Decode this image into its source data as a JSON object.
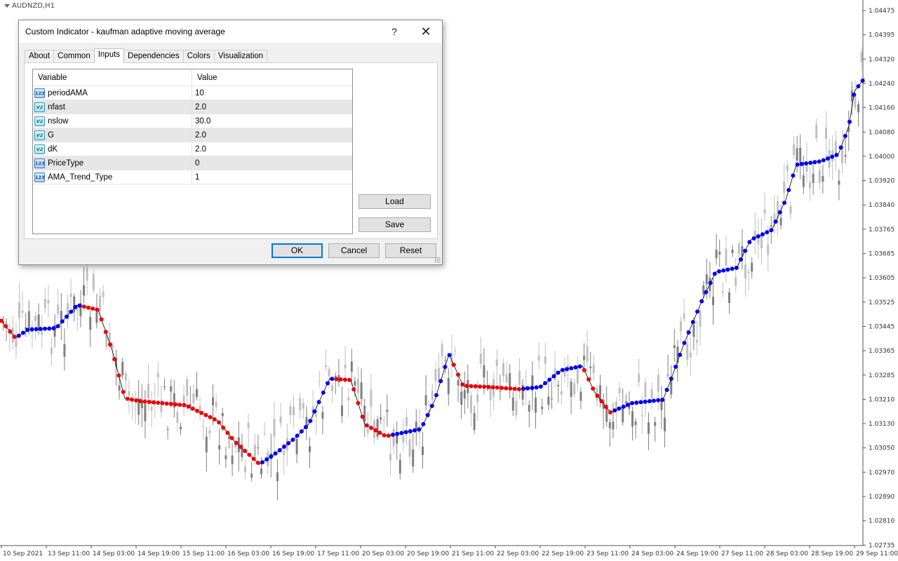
{
  "chart": {
    "symbol_label": "AUDNZD,H1",
    "price_labels": [
      "1.04475",
      "1.04395",
      "1.04320",
      "1.04240",
      "1.04160",
      "1.04080",
      "1.04000",
      "1.03920",
      "1.03840",
      "1.03765",
      "1.03685",
      "1.03605",
      "1.03525",
      "1.03445",
      "1.03365",
      "1.03285",
      "1.03210",
      "1.03130",
      "1.03050",
      "1.02970",
      "1.02890",
      "1.02810",
      "1.02735"
    ],
    "time_labels": [
      "10 Sep 2021",
      "13 Sep 11:00",
      "14 Sep 03:00",
      "14 Sep 19:00",
      "15 Sep 11:00",
      "16 Sep 03:00",
      "16 Sep 19:00",
      "17 Sep 11:00",
      "20 Sep 03:00",
      "20 Sep 19:00",
      "21 Sep 11:00",
      "22 Sep 03:00",
      "22 Sep 19:00",
      "23 Sep 11:00",
      "24 Sep 03:00",
      "24 Sep 19:00",
      "27 Sep 11:00",
      "28 Sep 03:00",
      "28 Sep 19:00",
      "29 Sep 11:00"
    ],
    "colors": {
      "bull_bar": "#c0c0c0",
      "bear_bar": "#808080",
      "ama_up": "#0000ee",
      "ama_down": "#ee0000",
      "ama_line": "#000000"
    }
  },
  "dialog": {
    "title": "Custom Indicator - kaufman adaptive moving average",
    "help_label": "?",
    "close_label": "✕",
    "tabs": [
      {
        "label": "About"
      },
      {
        "label": "Common"
      },
      {
        "label": "Inputs"
      },
      {
        "label": "Dependencies"
      },
      {
        "label": "Colors"
      },
      {
        "label": "Visualization"
      }
    ],
    "active_tab": "Inputs",
    "grid": {
      "header_variable": "Variable",
      "header_value": "Value",
      "rows": [
        {
          "icon": "123",
          "name": "periodAMA",
          "value": "10"
        },
        {
          "icon": "V2",
          "name": "nfast",
          "value": "2.0"
        },
        {
          "icon": "V2",
          "name": "nslow",
          "value": "30.0"
        },
        {
          "icon": "V2",
          "name": "G",
          "value": "2.0"
        },
        {
          "icon": "V2",
          "name": "dK",
          "value": "2.0"
        },
        {
          "icon": "123",
          "name": "PriceType",
          "value": "0"
        },
        {
          "icon": "123",
          "name": "AMA_Trend_Type",
          "value": "1"
        }
      ]
    },
    "buttons": {
      "load": "Load",
      "save": "Save",
      "ok": "OK",
      "cancel": "Cancel",
      "reset": "Reset"
    }
  }
}
